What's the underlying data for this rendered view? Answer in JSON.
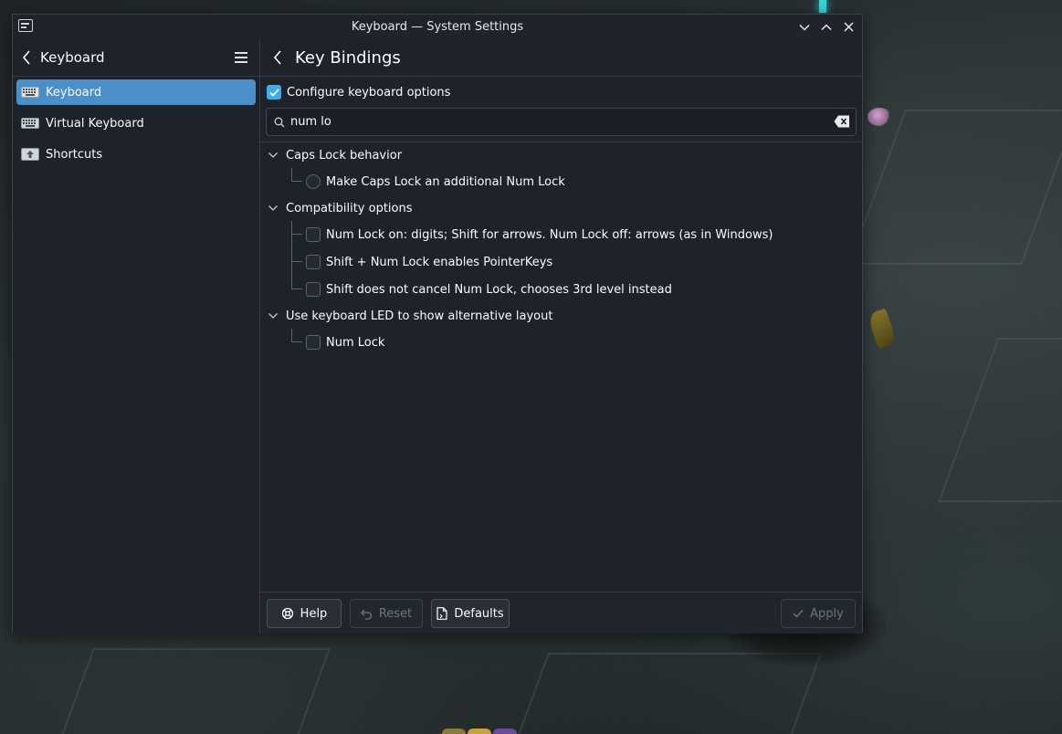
{
  "window": {
    "title": "Keyboard — System Settings"
  },
  "sidebar": {
    "title": "Keyboard",
    "items": [
      {
        "label": "Keyboard",
        "icon": "keyboard-icon",
        "active": true
      },
      {
        "label": "Virtual Keyboard",
        "icon": "virtual-keyboard-icon",
        "active": false
      },
      {
        "label": "Shortcuts",
        "icon": "shortcuts-icon",
        "active": false
      }
    ]
  },
  "main": {
    "title": "Key Bindings",
    "configure_label": "Configure keyboard options",
    "configure_checked": true,
    "search": {
      "value": "num lo",
      "placeholder": ""
    },
    "groups": [
      {
        "label": "Caps Lock behavior",
        "options": [
          {
            "label": "Make Caps Lock an additional Num Lock",
            "control": "radio",
            "checked": false
          }
        ]
      },
      {
        "label": "Compatibility options",
        "options": [
          {
            "label": "Num Lock on: digits; Shift for arrows. Num Lock off: arrows (as in Windows)",
            "control": "checkbox",
            "checked": false
          },
          {
            "label": "Shift + Num Lock enables PointerKeys",
            "control": "checkbox",
            "checked": false
          },
          {
            "label": "Shift does not cancel Num Lock, chooses 3rd level instead",
            "control": "checkbox",
            "checked": false
          }
        ]
      },
      {
        "label": "Use keyboard LED to show alternative layout",
        "options": [
          {
            "label": "Num Lock",
            "control": "checkbox",
            "checked": false
          }
        ]
      }
    ]
  },
  "footer": {
    "help_label": "Help",
    "reset_label": "Reset",
    "defaults_label": "Defaults",
    "apply_label": "Apply"
  },
  "colors": {
    "accent": "#3daee9",
    "selection": "#4b8fc9",
    "window_bg": "#1e232b"
  }
}
